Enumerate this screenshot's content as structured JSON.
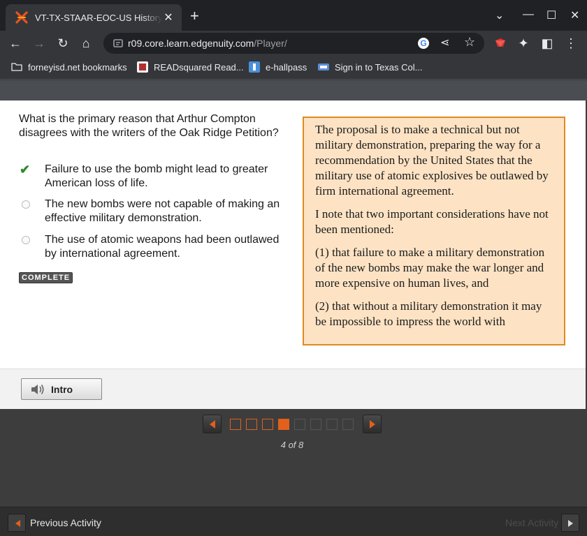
{
  "browser": {
    "tab_title": "VT-TX-STAAR-EOC-US History - Ir",
    "url_host": "r09.core.learn.edgenuity.com",
    "url_path": "/Player/",
    "bookmarks": [
      {
        "label": "forneyisd.net bookmarks",
        "icon": "folder-icon"
      },
      {
        "label": "READsquared Read...",
        "icon": "readsquared-icon"
      },
      {
        "label": "e-hallpass",
        "icon": "ehallpass-icon"
      },
      {
        "label": "Sign in to Texas Col...",
        "icon": "texas-college-icon"
      }
    ]
  },
  "question": {
    "prompt": "What is the primary reason that Arthur Compton disagrees with the writers of the Oak Ridge Petition?",
    "answers": [
      {
        "text": "Failure to use the bomb might lead to greater American loss of life.",
        "selected": true
      },
      {
        "text": "The new bombs were not capable of making an effective military demonstration.",
        "selected": false
      },
      {
        "text": "The use of atomic weapons had been outlawed by international agreement.",
        "selected": false
      }
    ],
    "status": "COMPLETE"
  },
  "passage": {
    "paragraphs": [
      "The proposal is to make a technical but not military demonstration, preparing the way for a recommendation by the United States that the military use of atomic explosives be outlawed by firm international agreement.",
      "I note that two important considerations have not been mentioned:",
      "(1) that failure to make a military demonstration of the new bombs may make the war longer and more expensive on human lives, and",
      "(2) that without a military demonstration it may be impossible to impress the world with"
    ]
  },
  "intro_button": "Intro",
  "pager": {
    "current": 4,
    "total": 8,
    "label": "4 of 8"
  },
  "footer": {
    "previous": "Previous Activity",
    "next": "Next Activity"
  },
  "colors": {
    "accent": "#e0601c",
    "passage_bg": "#fde3c4",
    "passage_border": "#e08a1e",
    "check": "#2e8b2e"
  }
}
